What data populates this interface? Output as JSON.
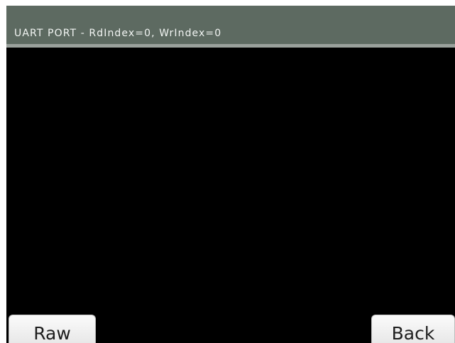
{
  "title_bar": {
    "text": "UART PORT - RdIndex=0, WrIndex=0"
  },
  "terminal": {
    "content": ""
  },
  "buttons": {
    "raw_label": "Raw",
    "back_label": "Back"
  },
  "colors": {
    "title_bar_bg": "#5d6a61",
    "title_bar_border": "#9aa19c",
    "terminal_bg": "#000000",
    "button_bg": "#f0f0f0"
  }
}
